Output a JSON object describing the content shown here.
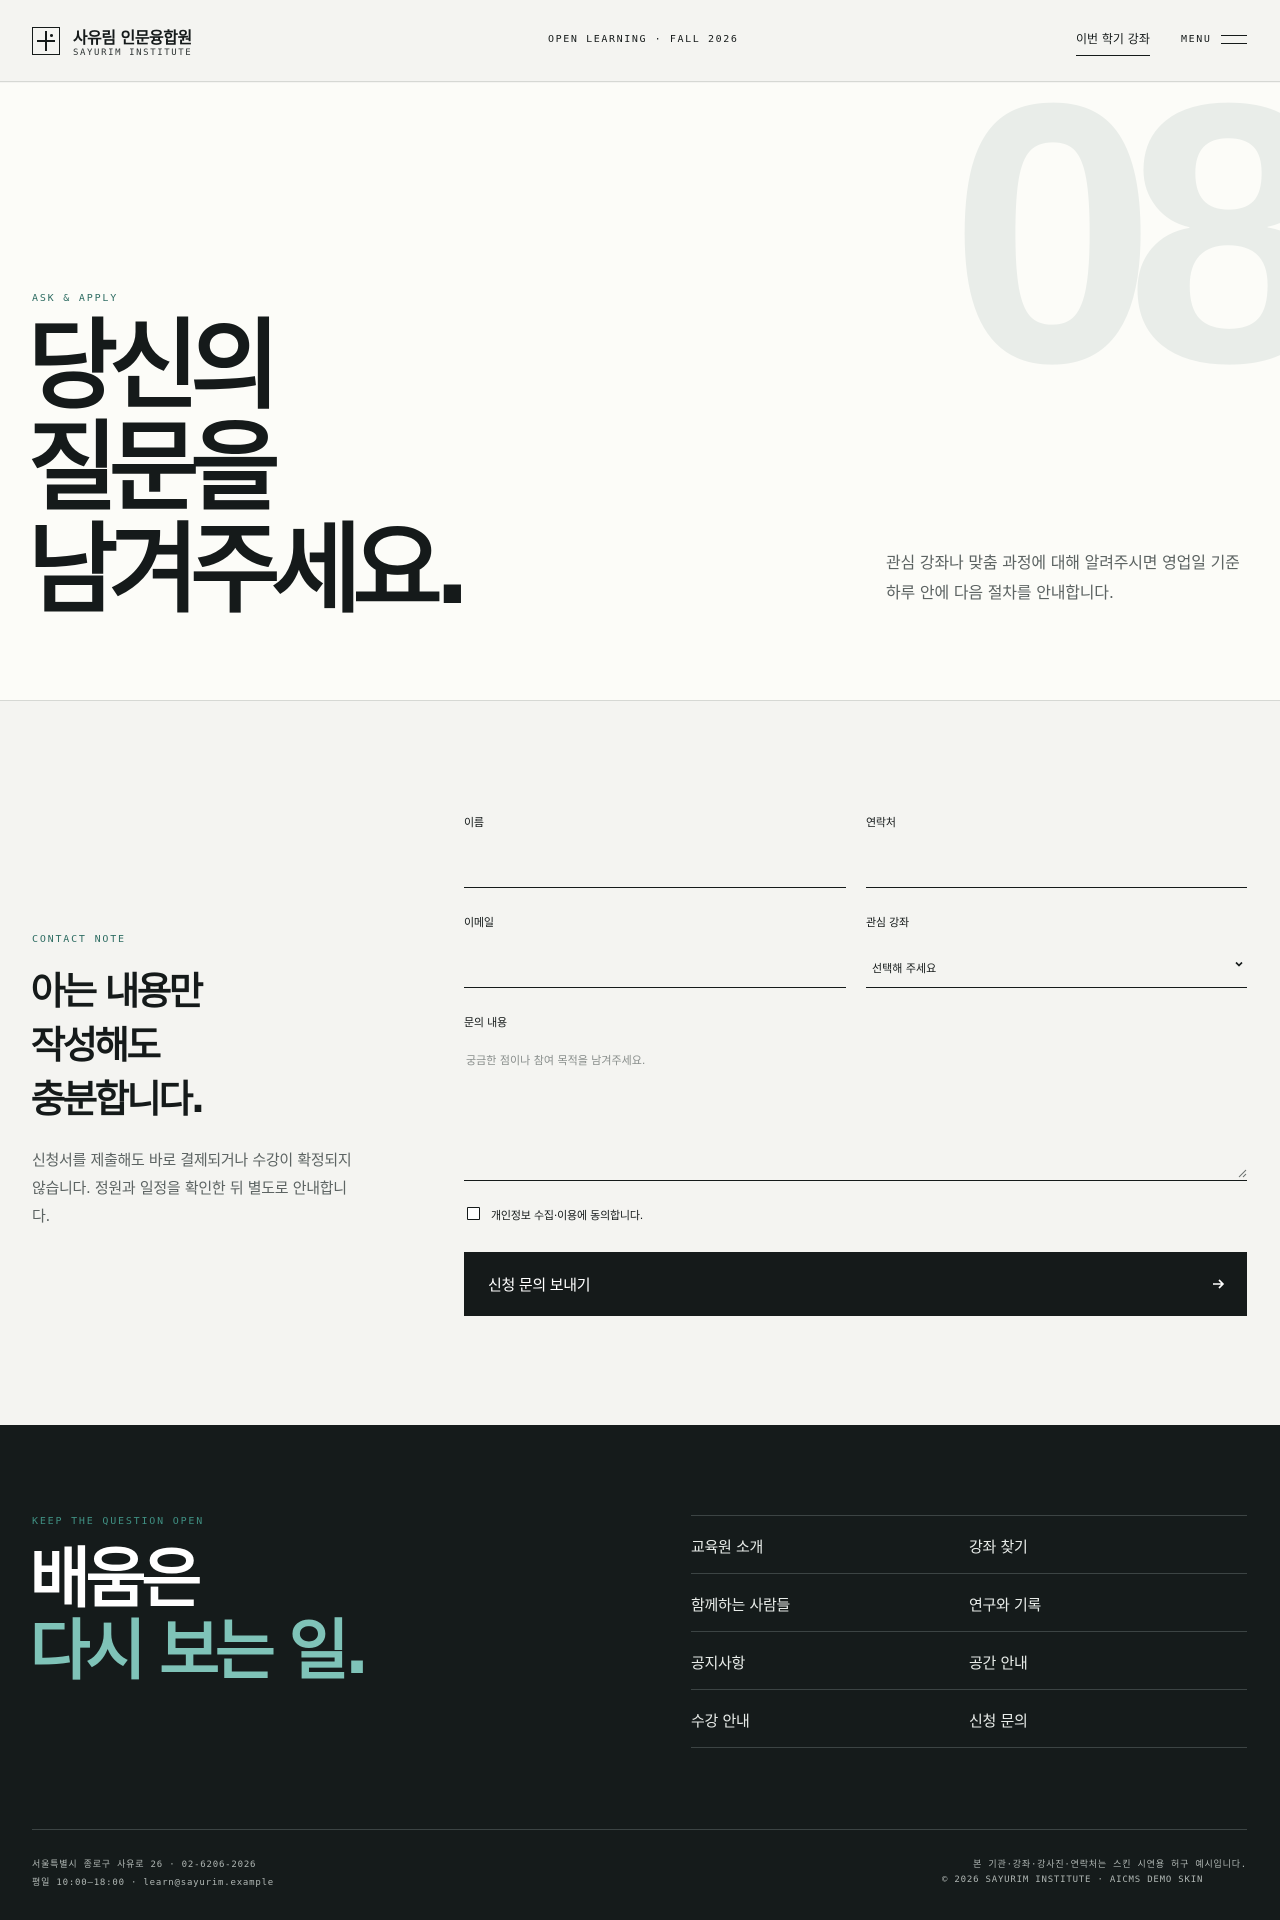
{
  "header": {
    "brand_title": "사유림 인문융합원",
    "brand_sub": "SAYURIM INSTITUTE",
    "center_text": "OPEN LEARNING · FALL 2026",
    "nav_link": "이번 학기 강좌",
    "menu_label": "MENU",
    "icons": {
      "logo": "square-cross-logo-icon",
      "menu": "hamburger-menu-icon"
    }
  },
  "hero": {
    "background_number": "08",
    "eyebrow": "ASK & APPLY",
    "title_lines": [
      "당신의",
      "질문을",
      "남겨주세요."
    ],
    "description": "관심 강좌나 맞춤 과정에 대해 알려주시면 영업일 기준 하루 안에 다음 절차를 안내합니다."
  },
  "contact": {
    "eyebrow": "CONTACT NOTE",
    "title_lines": [
      "아는 내용만",
      "작성해도",
      "충분합니다."
    ],
    "note": "신청서를 제출해도 바로 결제되거나 수강이 확정되지 않습니다. 정원과 일정을 확인한 뒤 별도로 안내합니다.",
    "form": {
      "name_label": "이름",
      "name_value": "",
      "phone_label": "연락처",
      "phone_value": "",
      "email_label": "이메일",
      "email_value": "",
      "course_label": "관심 강좌",
      "course_selected": "선택해 주세요",
      "message_label": "문의 내용",
      "message_placeholder": "궁금한 점이나 참여 목적을 남겨주세요.",
      "consent_label": "개인정보 수집·이용에 동의합니다.",
      "consent_checked": false,
      "submit_label": "신청 문의 보내기"
    },
    "icons": {
      "select": "chevron-down-icon",
      "submit": "arrow-right-icon",
      "resize": "resize-grip-icon"
    }
  },
  "footer": {
    "eyebrow": "KEEP THE QUESTION OPEN",
    "title_line1": "배움은",
    "title_line2": "다시 보는 일.",
    "links": [
      "교육원 소개",
      "강좌 찾기",
      "함께하는 사람들",
      "연구와 기록",
      "공지사항",
      "공간 안내",
      "수강 안내",
      "신청 문의"
    ],
    "address": "서울특별시 종로구 사유로 26 · 02-6206-2026",
    "hours": "평일 10:00–18:00 · learn@sayurim.example",
    "disclaimer": "본 기관·강좌·강사진·연락처는 스킨 시연용 허구 예시입니다.",
    "copyright": "© 2026 SAYURIM INSTITUTE · AICMS DEMO SKIN"
  },
  "colors": {
    "ink": "#151a1a",
    "accent_green": "#2f6d63",
    "footer_accent": "#7fc3b8",
    "page_bg": "#f4f4f1",
    "hero_bg": "#fcfcf8",
    "footer_bg": "#151b1b"
  }
}
